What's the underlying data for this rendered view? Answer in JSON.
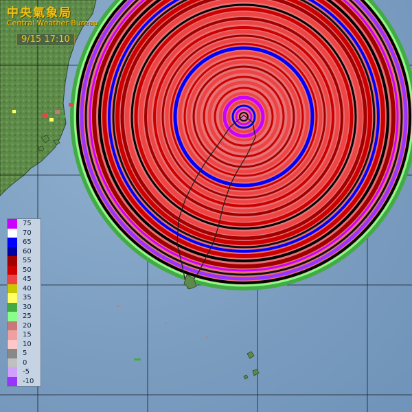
{
  "header": {
    "title_zh": "中央氣象局",
    "title_en": "Central Weather Bureau",
    "timestamp": "9/15  17:10"
  },
  "legend": {
    "items": [
      {
        "label": "75",
        "color": "#cc00ff"
      },
      {
        "label": "70",
        "color": "#ffffff"
      },
      {
        "label": "65",
        "color": "#0000ff"
      },
      {
        "label": "60",
        "color": "#0000a0"
      },
      {
        "label": "55",
        "color": "#a00000"
      },
      {
        "label": "50",
        "color": "#cc0000"
      },
      {
        "label": "45",
        "color": "#ee4444"
      },
      {
        "label": "40",
        "color": "#c8c800"
      },
      {
        "label": "35",
        "color": "#ffff66"
      },
      {
        "label": "30",
        "color": "#44aa44"
      },
      {
        "label": "25",
        "color": "#88ff88"
      },
      {
        "label": "20",
        "color": "#c87878"
      },
      {
        "label": "15",
        "color": "#f0a0a0"
      },
      {
        "label": "10",
        "color": "#ffc8c8"
      },
      {
        "label": "5",
        "color": "#888888"
      },
      {
        "label": "0",
        "color": "#c0c0c0"
      },
      {
        "label": "-5",
        "color": "#d0a0ff"
      },
      {
        "label": "-10",
        "color": "#9933ff"
      }
    ]
  },
  "map": {
    "background_color": "#7a9cbf",
    "land_color": "#4f7a3a",
    "grid_color": "#000000"
  }
}
